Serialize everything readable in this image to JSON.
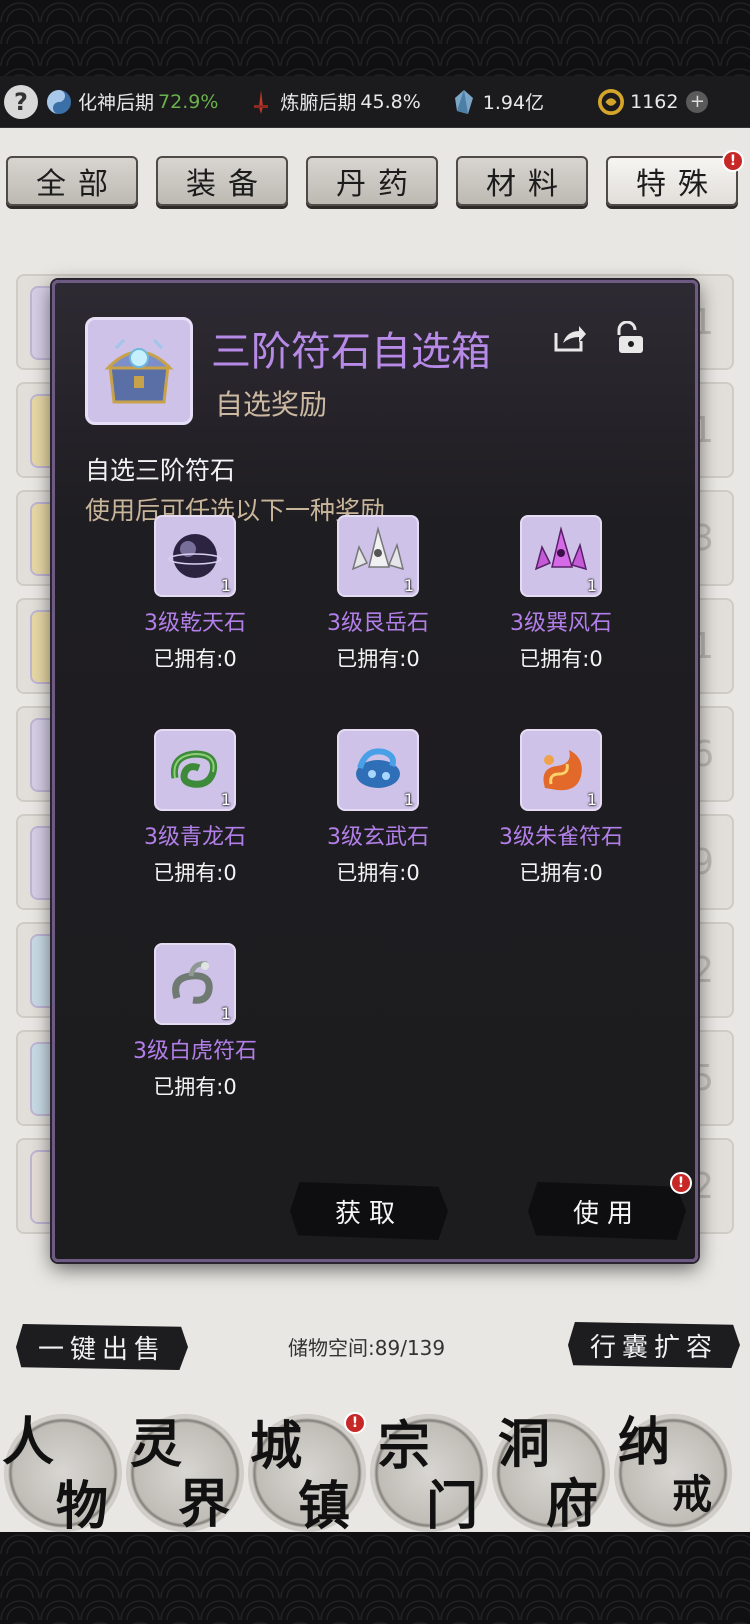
{
  "resources": {
    "realm1": {
      "name": "化神后期",
      "pct": "72.9%"
    },
    "realm2": {
      "name": "炼腑后期",
      "pct": "45.8%"
    },
    "stone": "1.94亿",
    "gold": "1162"
  },
  "tabs": [
    "全部",
    "装备",
    "丹药",
    "材料",
    "特殊"
  ],
  "background_counts": [
    "1",
    "1",
    "3",
    "x1",
    "x6",
    "x19",
    "x2242",
    "x5",
    "2"
  ],
  "modal": {
    "title": "三阶符石自选箱",
    "subtitle": "自选奖励",
    "desc_line1": "自选三阶符石",
    "desc_line2": "使用后可任选以下一种奖励",
    "rewards": [
      {
        "name": "3级乾天石",
        "owned": "已拥有:0",
        "qty": "1"
      },
      {
        "name": "3级艮岳石",
        "owned": "已拥有:0",
        "qty": "1"
      },
      {
        "name": "3级巽风石",
        "owned": "已拥有:0",
        "qty": "1"
      },
      {
        "name": "3级青龙石",
        "owned": "已拥有:0",
        "qty": "1"
      },
      {
        "name": "3级玄武石",
        "owned": "已拥有:0",
        "qty": "1"
      },
      {
        "name": "3级朱雀符石",
        "owned": "已拥有:0",
        "qty": "1"
      },
      {
        "name": "3级白虎符石",
        "owned": "已拥有:0",
        "qty": "1"
      }
    ],
    "btn_get": "获取",
    "btn_use": "使用"
  },
  "footer": {
    "sell_all": "一键出售",
    "storage_label": "储物空间:",
    "storage_value": "89/139",
    "expand": "行囊扩容"
  },
  "nav": [
    {
      "top": "人",
      "bottom": "物"
    },
    {
      "top": "灵",
      "bottom": "界"
    },
    {
      "top": "城",
      "bottom": "镇"
    },
    {
      "top": "宗",
      "bottom": "门"
    },
    {
      "top": "洞",
      "bottom": "府"
    },
    {
      "top": "纳",
      "bottom": "戒"
    }
  ],
  "colors": {
    "accent": "#b27fe8",
    "badge": "#c62828"
  }
}
